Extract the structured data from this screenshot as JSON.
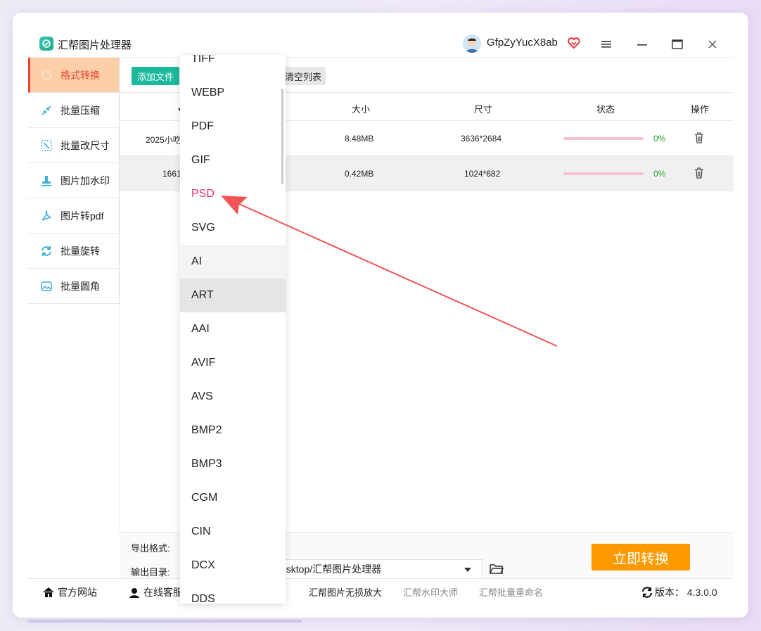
{
  "app": {
    "title": "汇帮图片处理器",
    "username": "GfpZyYucX8ab"
  },
  "sidebar": {
    "items": [
      {
        "label": "格式转换",
        "icon": "gear-icon"
      },
      {
        "label": "批量压缩",
        "icon": "compress-icon"
      },
      {
        "label": "批量改尺寸",
        "icon": "resize-icon"
      },
      {
        "label": "图片加水印",
        "icon": "stamp-icon"
      },
      {
        "label": "图片转pdf",
        "icon": "pdf-icon"
      },
      {
        "label": "批量旋转",
        "icon": "rotate-icon"
      },
      {
        "label": "批量圆角",
        "icon": "image-icon"
      }
    ]
  },
  "toolbar": {
    "add_label": "添加文件",
    "clear_label": "清空列表"
  },
  "table": {
    "headers": [
      "大小",
      "尺寸",
      "状态",
      "操作"
    ],
    "rows": [
      {
        "name": "2025小吃",
        "size": "8.48MB",
        "dim": "3636*2684",
        "pct": "0%",
        "progress": 0
      },
      {
        "name": "1661",
        "size": "0.42MB",
        "dim": "1024*682",
        "pct": "0%",
        "progress": 0
      }
    ]
  },
  "dropdown": {
    "items": [
      "TIFF",
      "WEBP",
      "PDF",
      "GIF",
      "PSD",
      "SVG",
      "AI",
      "ART",
      "AAI",
      "AVIF",
      "AVS",
      "BMP2",
      "BMP3",
      "CGM",
      "CIN",
      "DCX",
      "DDS"
    ],
    "selected": "PSD"
  },
  "bottom": {
    "format_label": "导出格式:",
    "output_label": "输出目录:",
    "output_path": "esktop/汇帮图片处理器",
    "convert_label": "立即转换"
  },
  "footer": {
    "website": "官方网站",
    "service": "在线客服",
    "link1": "汇帮图片无损放大",
    "link2": "汇帮水印大师",
    "link3": "汇帮批量重命名",
    "version": "版本： 4.3.0.0"
  },
  "colors": {
    "accent": "#1cb89c",
    "active_bg": "#fdcfa8",
    "active_text": "#e8432f",
    "convert": "#fc9a00",
    "selected": "#e0306a",
    "arrow": "#f05454"
  }
}
